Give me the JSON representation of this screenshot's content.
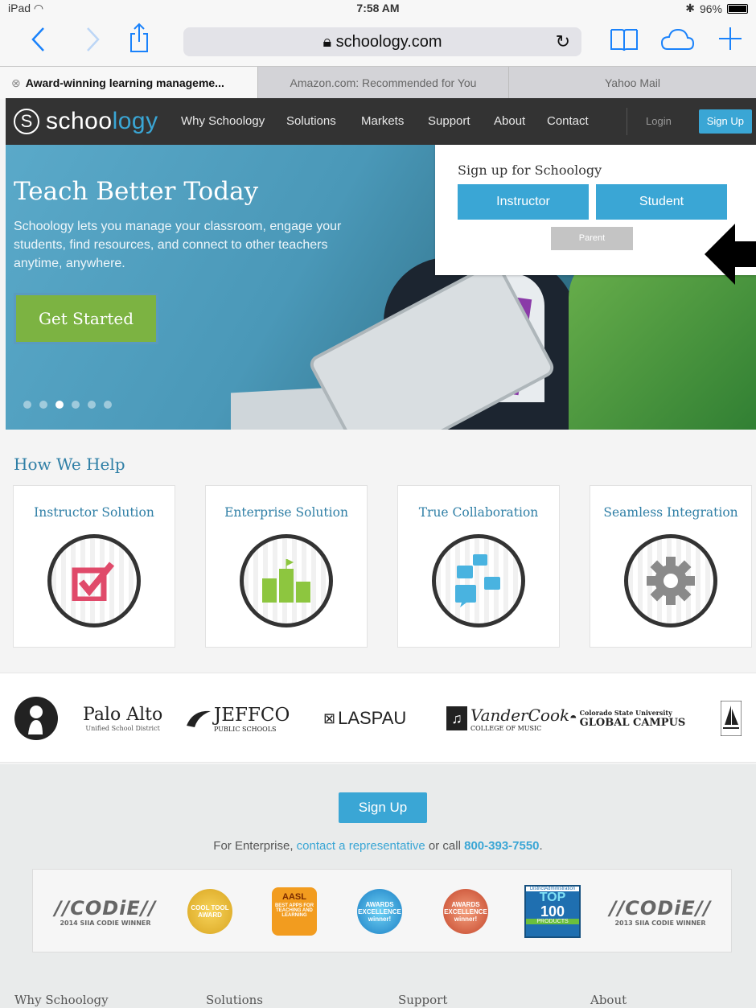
{
  "status_bar": {
    "device": "iPad",
    "time": "7:58 AM",
    "battery": "96%"
  },
  "browser": {
    "url": "schoology.com",
    "tabs": [
      {
        "label": "Award-winning learning manageme...",
        "active": true
      },
      {
        "label": "Amazon.com: Recommended for You",
        "active": false
      },
      {
        "label": "Yahoo Mail",
        "active": false
      }
    ]
  },
  "nav": {
    "logo_text_a": "schoo",
    "logo_text_b": "logy",
    "links": [
      "Why Schoology",
      "Solutions",
      "Markets",
      "Support",
      "About",
      "Contact"
    ],
    "login": "Login",
    "signup": "Sign Up"
  },
  "hero": {
    "title": "Teach Better Today",
    "text": "Schoology lets you manage your classroom, engage your students, find resources, and connect to other teachers anytime, anywhere.",
    "cta": "Get Started",
    "slides": 6,
    "active_slide": 3
  },
  "signup_box": {
    "title": "Sign up for Schoology",
    "instructor": "Instructor",
    "student": "Student",
    "parent": "Parent"
  },
  "help": {
    "title": "How We Help",
    "cards": [
      "Instructor Solution",
      "Enterprise Solution",
      "True Collaboration",
      "Seamless Integration"
    ]
  },
  "partners": {
    "palo_alto": "Palo Alto",
    "palo_alto_sub": "Unified School District",
    "jeffco": "JEFFCO",
    "jeffco_sub": "PUBLIC SCHOOLS",
    "laspau": "LASPAU",
    "vandercook": "VanderCook",
    "vandercook_sub": "COLLEGE OF MUSIC",
    "csu_top": "Colorado State University",
    "csu": "GLOBAL CAMPUS"
  },
  "footer": {
    "signup": "Sign Up",
    "enterprise_pre": "For Enterprise, ",
    "enterprise_link": "contact a representative",
    "enterprise_mid": " or call ",
    "phone": "800-393-7550",
    "enterprise_end": ".",
    "columns": [
      "Why Schoology",
      "Solutions",
      "Support",
      "About"
    ]
  },
  "awards": {
    "codie_left": "//CODiE//",
    "codie_left_sub": "2014 SIIA CODIE WINNER",
    "codie_right": "//CODiE//",
    "codie_right_sub": "2013 SIIA CODIE WINNER",
    "cool_tool": "COOL TOOL AWARD",
    "aasl": "AASL",
    "aasl_sub": "BEST APPS FOR TEACHING AND LEARNING",
    "excellence1": "AWARDS EXCELLENCE winner!",
    "excellence2": "AWARDS EXCELLENCE winner!",
    "top100_a": "DistrictAdministration",
    "top100_b": "TOP",
    "top100_c": "100",
    "top100_d": "PRODUCTS"
  }
}
